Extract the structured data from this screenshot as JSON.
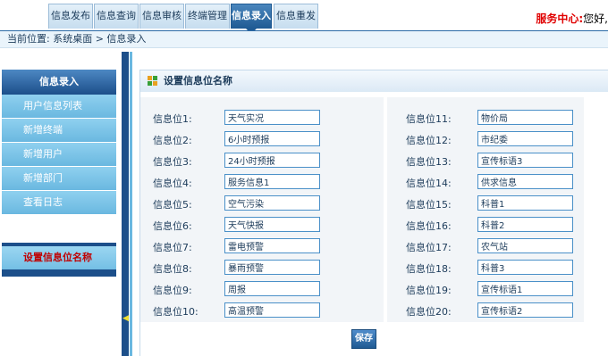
{
  "nav": {
    "tabs": [
      {
        "label": "信息发布"
      },
      {
        "label": "信息查询"
      },
      {
        "label": "信息审核"
      },
      {
        "label": "终端管理"
      },
      {
        "label": "信息录入"
      },
      {
        "label": "信息重发"
      }
    ],
    "active_tab": "信息录入",
    "service_label": "服务中心:",
    "greeting": "您好,"
  },
  "location": {
    "text": "当前位置: 系统桌面 > 信息录入"
  },
  "sidebar": {
    "header": "信息录入",
    "items": [
      {
        "label": "用户信息列表"
      },
      {
        "label": "新增终端"
      },
      {
        "label": "新增用户"
      },
      {
        "label": "新增部门"
      },
      {
        "label": "查看日志"
      }
    ],
    "active_item": "设置信息位名称"
  },
  "panel": {
    "title": "设置信息位名称",
    "left_fields": [
      {
        "label": "信息位1:",
        "value": "天气实况"
      },
      {
        "label": "信息位2:",
        "value": "6小时预报"
      },
      {
        "label": "信息位3:",
        "value": "24小时预报"
      },
      {
        "label": "信息位4:",
        "value": "服务信息1"
      },
      {
        "label": "信息位5:",
        "value": "空气污染"
      },
      {
        "label": "信息位6:",
        "value": "天气快报"
      },
      {
        "label": "信息位7:",
        "value": "雷电预警"
      },
      {
        "label": "信息位8:",
        "value": "暴雨预警"
      },
      {
        "label": "信息位9:",
        "value": "周报"
      },
      {
        "label": "信息位10:",
        "value": "高温预警"
      }
    ],
    "right_fields": [
      {
        "label": "信息位11:",
        "value": "物价局"
      },
      {
        "label": "信息位12:",
        "value": "市纪委"
      },
      {
        "label": "信息位13:",
        "value": "宣传标语3"
      },
      {
        "label": "信息位14:",
        "value": "供求信息"
      },
      {
        "label": "信息位15:",
        "value": "科普1"
      },
      {
        "label": "信息位16:",
        "value": "科普2"
      },
      {
        "label": "信息位17:",
        "value": "农气站"
      },
      {
        "label": "信息位18:",
        "value": "科普3"
      },
      {
        "label": "信息位19:",
        "value": "宣传标语1"
      },
      {
        "label": "信息位20:",
        "value": "宣传标语2"
      }
    ],
    "save_label": "保存"
  },
  "colors": {
    "accent": "#1f5a93",
    "sidebar_item": "#6ab8e0",
    "service_red": "#e00000",
    "active_item_red": "#c00000"
  },
  "icons": {
    "panel_icon": "grid-icon",
    "splitter_icon": "arrow-left-icon"
  }
}
